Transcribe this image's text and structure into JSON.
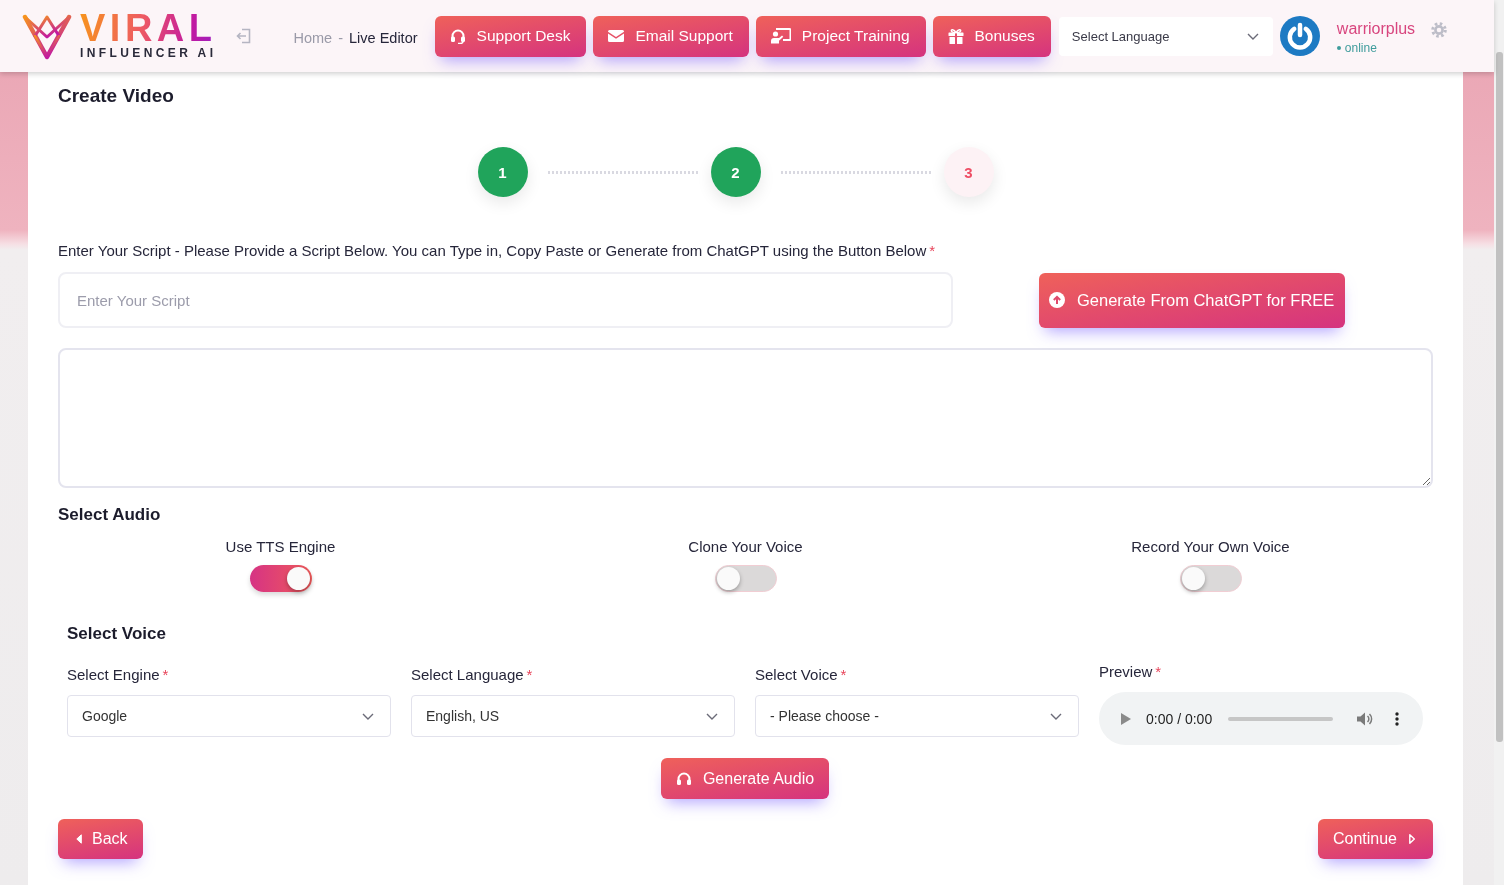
{
  "header": {
    "logo": {
      "title": "VIRAL",
      "subtitle": "INFLUENCER AI"
    },
    "breadcrumb": {
      "items": [
        {
          "label": "Home",
          "current": false
        },
        {
          "label": "Live Editor",
          "current": true
        }
      ],
      "separator": "-"
    },
    "nav_buttons": [
      "Support Desk",
      "Email Support",
      "Project Training",
      "Bonuses"
    ],
    "language_select": {
      "value": "Select Language"
    },
    "user": {
      "name": "warriorplus",
      "status": "online"
    }
  },
  "page_title": "Create Video",
  "stepper": {
    "steps": [
      {
        "label": "1",
        "completed": true
      },
      {
        "label": "2",
        "completed": true
      },
      {
        "label": "3",
        "completed": false
      }
    ]
  },
  "script": {
    "label": "Enter Your Script - Please Provide a Script Below. You can Type in, Copy Paste or Generate from ChatGPT using the Button Below",
    "required_mark": "*",
    "placeholder": "Enter Your Script",
    "generate_button": "Generate From ChatGPT for FREE"
  },
  "audio": {
    "title": "Select Audio",
    "options": [
      {
        "label": "Use TTS Engine",
        "on": true
      },
      {
        "label": "Clone Your Voice",
        "on": false
      },
      {
        "label": "Record Your Own Voice",
        "on": false
      }
    ]
  },
  "voice": {
    "title": "Select Voice",
    "selects": [
      {
        "label": "Select Engine",
        "required_mark": "*",
        "value": "Google"
      },
      {
        "label": "Select Language",
        "required_mark": "*",
        "value": "English, US"
      },
      {
        "label": "Select Voice",
        "required_mark": "*",
        "value": "- Please choose -"
      }
    ],
    "preview": {
      "label": "Preview",
      "required_mark": "*",
      "time": "0:00 / 0:00"
    },
    "generate_button": "Generate Audio"
  },
  "footer": {
    "back_button": "Back",
    "continue_button": "Continue"
  }
}
